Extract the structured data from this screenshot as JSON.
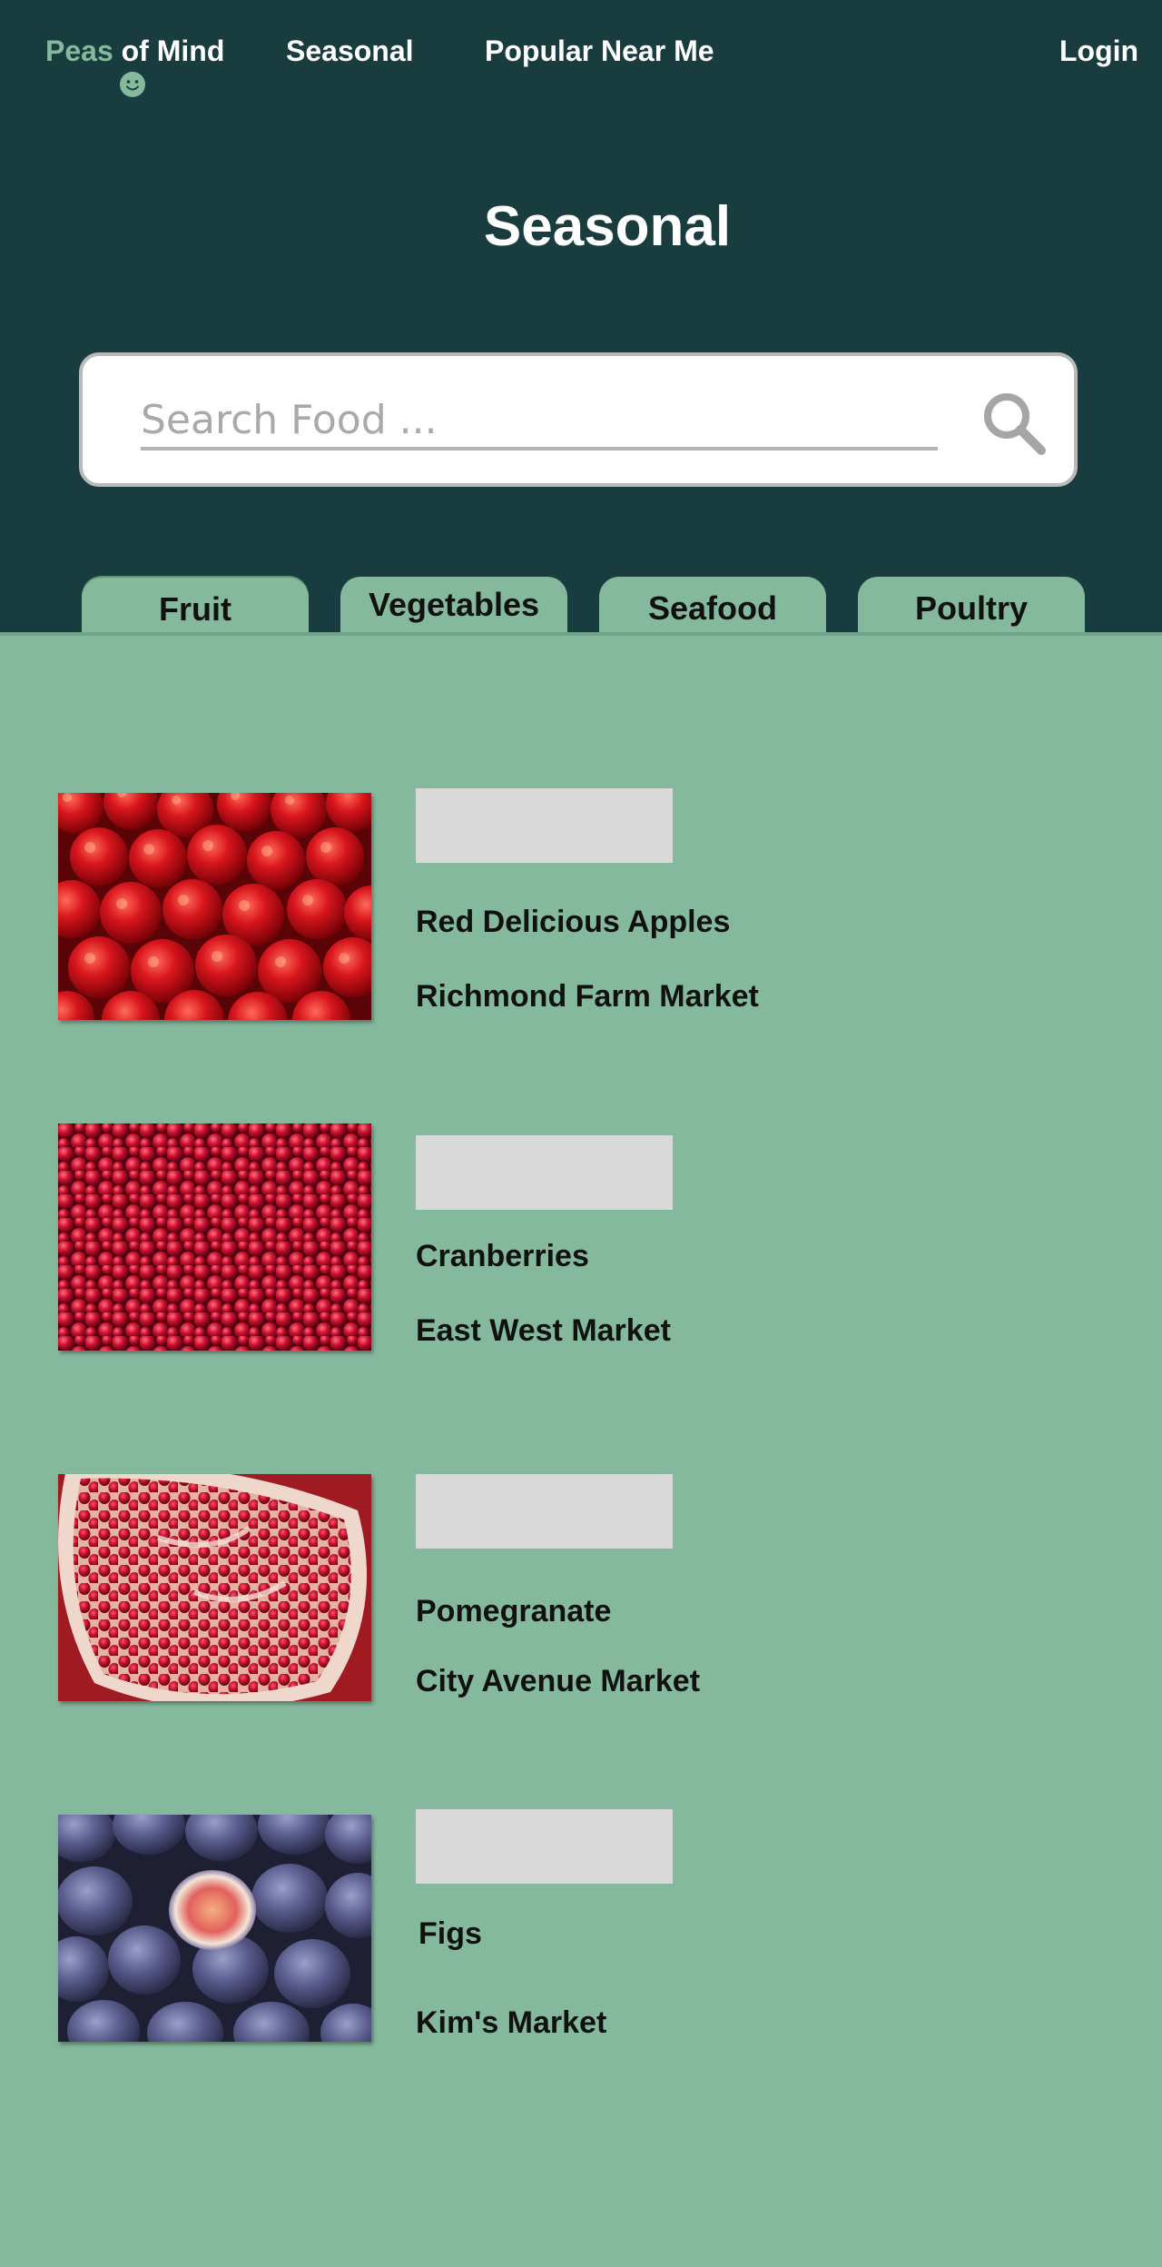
{
  "nav": {
    "logo_first": "Peas",
    "logo_rest": " of Mind",
    "links": [
      "Seasonal",
      "Popular Near Me"
    ],
    "login": "Login"
  },
  "page_title": "Seasonal",
  "search": {
    "placeholder": "Search Food ...",
    "icon": "search-icon"
  },
  "tabs": [
    {
      "label": "Fruit",
      "active": true
    },
    {
      "label": "Vegetables",
      "active": false
    },
    {
      "label": "Seafood",
      "active": false
    },
    {
      "label": "Poultry",
      "active": false
    }
  ],
  "items": [
    {
      "name": "Red Delicious Apples",
      "market": "Richmond Farm Market",
      "image": "apples-image"
    },
    {
      "name": "Cranberries",
      "market": "East West Market",
      "image": "cranberries-image"
    },
    {
      "name": "Pomegranate",
      "market": "City Avenue Market",
      "image": "pomegranate-image"
    },
    {
      "name": "Figs",
      "market": "Kim's Market",
      "image": "figs-image"
    }
  ],
  "colors": {
    "header_bg": "#193d3e",
    "accent_green": "#84b99e",
    "placeholder_gray": "#d9d9d9"
  }
}
